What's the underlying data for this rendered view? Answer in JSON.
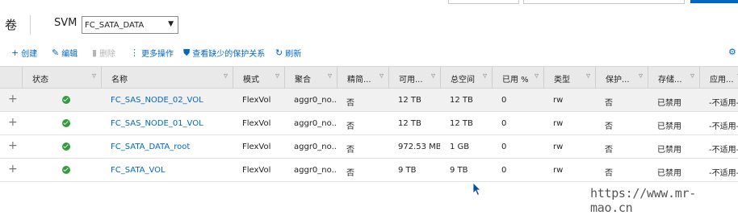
{
  "page": {
    "title": "卷",
    "svm_label": "SVM",
    "svm_value": "FC_SATA_DATA"
  },
  "toolbar": {
    "create": "创建",
    "edit": "编辑",
    "delete": "删除",
    "more": "更多操作",
    "protect": "查看缺少的保护关系",
    "refresh": "刷新"
  },
  "columns": [
    "状态",
    "名称",
    "模式",
    "聚合",
    "精简...",
    "可用...",
    "总空间",
    "已用 %",
    "类型",
    "保护...",
    "存储...",
    "应用..."
  ],
  "rows": [
    {
      "name": "FC_SAS_NODE_02_VOL",
      "mode": "FlexVol",
      "aggr": "aggr0_no...",
      "thin": "否",
      "avail": "12 TB",
      "total": "12 TB",
      "used": "0",
      "type": "rw",
      "protect": "否",
      "storage": "已禁用",
      "app": "-不适用-"
    },
    {
      "name": "FC_SAS_NODE_01_VOL",
      "mode": "FlexVol",
      "aggr": "aggr0_no...",
      "thin": "否",
      "avail": "12 TB",
      "total": "12 TB",
      "used": "0",
      "type": "rw",
      "protect": "否",
      "storage": "已禁用",
      "app": "-不适用-"
    },
    {
      "name": "FC_SATA_DATA_root",
      "mode": "FlexVol",
      "aggr": "aggr0_no...",
      "thin": "否",
      "avail": "972.53 MB",
      "total": "1 GB",
      "used": "0",
      "type": "rw",
      "protect": "否",
      "storage": "已禁用",
      "app": "-不适用-"
    },
    {
      "name": "FC_SATA_VOL",
      "mode": "FlexVol",
      "aggr": "aggr0_no...",
      "thin": "否",
      "avail": "9 TB",
      "total": "9 TB",
      "used": "0",
      "type": "rw",
      "protect": "否",
      "storage": "已禁用",
      "app": "-不适用-"
    }
  ],
  "watermark": "https://www.mr-mao.cn",
  "colors": {
    "accent": "#0067c5",
    "ok": "#2e9e3b"
  }
}
